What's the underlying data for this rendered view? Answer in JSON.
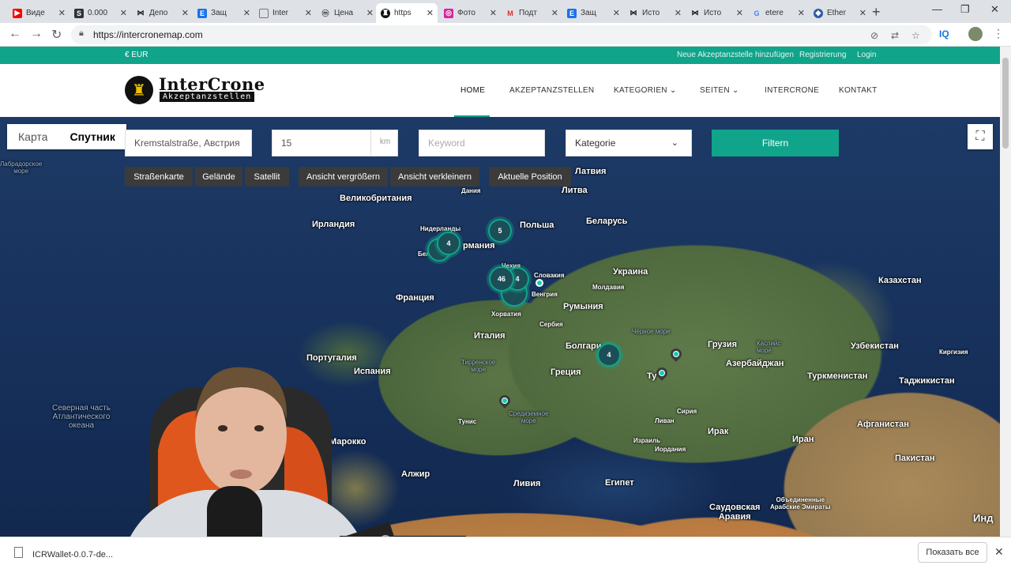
{
  "browser": {
    "tabs": [
      {
        "label": "Виде",
        "icon": "youtube-icon",
        "color": "#ff0000"
      },
      {
        "label": "0.000",
        "icon": "s-logo-icon",
        "color": "#333333"
      },
      {
        "label": "Депо",
        "icon": "bowtie-icon",
        "color": "#111111"
      },
      {
        "label": "Защ",
        "icon": "ex-icon",
        "color": "#1a73e8"
      },
      {
        "label": "Inter",
        "icon": "page-icon",
        "color": "#777777"
      },
      {
        "label": "Цена",
        "icon": "m-logo-icon",
        "color": "#333333"
      },
      {
        "label": "https",
        "icon": "intercrone-icon",
        "color": "#111111"
      },
      {
        "label": "Фото",
        "icon": "instagram-icon",
        "color": "#d6249f"
      },
      {
        "label": "Подт",
        "icon": "gmail-icon",
        "color": "#d93025"
      },
      {
        "label": "Защ",
        "icon": "ex-icon",
        "color": "#1a73e8"
      },
      {
        "label": "Исто",
        "icon": "bowtie-icon",
        "color": "#111111"
      },
      {
        "label": "Исто",
        "icon": "bowtie-icon",
        "color": "#111111"
      },
      {
        "label": "etere",
        "icon": "google-icon",
        "color": "#4285f4"
      },
      {
        "label": "Ether",
        "icon": "ethereum-icon",
        "color": "#2b5ca8"
      }
    ],
    "url": "https://intercronemap.com",
    "profile_label": "IQ"
  },
  "site": {
    "currency": "€ EUR",
    "top_links": {
      "add": "Neue Akzeptanzstelle hinzufügen",
      "register": "Registrierung",
      "login": "Login"
    },
    "logo_title": "InterCrone",
    "logo_sub": "Akzeptanzstellen",
    "nav": {
      "home": "HOME",
      "akzeptanz": "AKZEPTANZSTELLEN",
      "kategorien": "KATEGORIEN",
      "seiten": "SEITEN",
      "intercrone": "INTERCRONE",
      "kontakt": "KONTAKT"
    },
    "accent": "#10a48a"
  },
  "map": {
    "map_type": {
      "map": "Карта",
      "satellite": "Спутник"
    },
    "location_value": "Kremstalstraße, Австрия",
    "radius_value": "15",
    "radius_unit": "km",
    "keyword_placeholder": "Keyword",
    "category_value": "Kategorie",
    "filter_label": "Filtern",
    "buttons": {
      "roadmap": "Straßenkarte",
      "terrain": "Gelände",
      "satellite": "Satellit",
      "zoom_in": "Ansicht vergrößern",
      "zoom_out": "Ansicht verkleinern",
      "position": "Aktuelle Position"
    },
    "labels": {
      "labrador": "Лабрадорское\nморе",
      "latvia": "Латвия",
      "lithuania": "Литва",
      "denmark": "Дания",
      "uk": "Великобритания",
      "ireland": "Ирландия",
      "netherlands": "Нидерланды",
      "poland": "Польша",
      "belarus": "Беларусь",
      "germany": "рмания",
      "belgium": "Бел",
      "czech": "Чехия",
      "slovakia": "Словакия",
      "ukraine": "Украина",
      "kazakhstan": "Казахстан",
      "moldova": "Молдавия",
      "hungary": "Венгрия",
      "france": "Франция",
      "romania": "Румыния",
      "croatia": "Хорватия",
      "serbia": "Сербия",
      "black_sea": "Чёрное море",
      "italy": "Италия",
      "georgia": "Грузия",
      "bulgaria": "Болгари",
      "caspian": "Каспийс\nморе",
      "uzbekistan": "Узбекистан",
      "kyrgyzstan": "Киргизия",
      "portugal": "Португалия",
      "spain": "Испания",
      "tyrrhenian": "Тирренское\nморе",
      "greece": "Греция",
      "azerbaijan": "Азербайджан",
      "turkmenistan": "Туркменистан",
      "tajikistan": "Таджикистан",
      "turkey": "Ту",
      "north_atlantic": "Северная часть\nАтлантического\nокеана",
      "tunisia": "Тунис",
      "mediterranean": "Средиземное\nморе",
      "syria": "Сирия",
      "lebanon": "Ливан",
      "iraq": "Ирак",
      "iran": "Иран",
      "afghanistan": "Афганистан",
      "morocco": "Марокко",
      "israel": "Израиль",
      "jordan": "Иордания",
      "pakistan": "Пакистан",
      "algeria": "Алжир",
      "libya": "Ливия",
      "egypt": "Египет",
      "uae": "Объединенные\nАрабские Эмираты",
      "saudi": "Саудовская\nАравия",
      "india": "Инд"
    },
    "clusters": {
      "c1": "5",
      "c2": "4",
      "c3": "46",
      "c4": "4",
      "c5": "4"
    }
  },
  "downloads": {
    "file_name": "ICRWallet-0.0.7-de...",
    "show_all": "Показать все"
  }
}
